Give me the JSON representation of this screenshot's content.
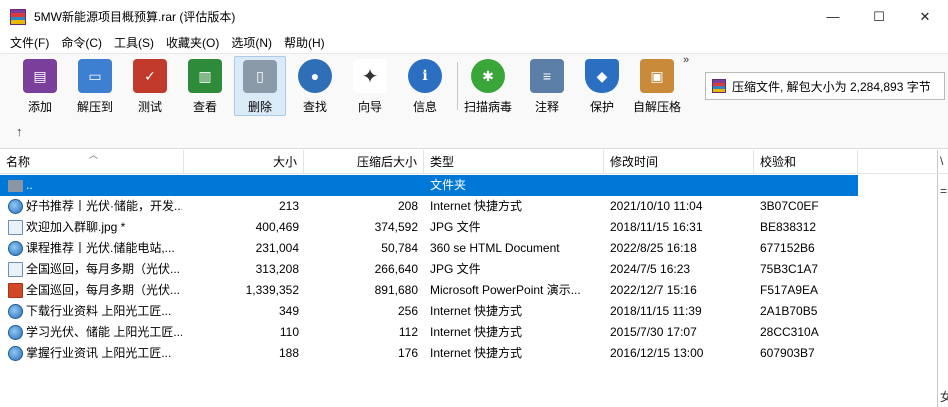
{
  "window": {
    "title": "5MW新能源项目概预算.rar (评估版本)",
    "controls": {
      "minimize": "—",
      "maximize": "☐",
      "close": "✕"
    }
  },
  "menu": [
    "文件(F)",
    "命令(C)",
    "工具(S)",
    "收藏夹(O)",
    "选项(N)",
    "帮助(H)"
  ],
  "toolbar": {
    "buttons": [
      {
        "label": "添加",
        "icon": "add-archive-icon",
        "color": "#7a3f9a"
      },
      {
        "label": "解压到",
        "icon": "extract-to-icon",
        "color": "#3d7fd1"
      },
      {
        "label": "测试",
        "icon": "test-clipboard-icon",
        "color": "#c0392b"
      },
      {
        "label": "查看",
        "icon": "view-book-icon",
        "color": "#2e8b3a"
      },
      {
        "label": "删除",
        "icon": "trash-icon",
        "color": "#8a9aa8"
      },
      {
        "label": "查找",
        "icon": "find-magnifier-icon",
        "color": "#2f6fb8"
      },
      {
        "label": "向导",
        "icon": "wizard-wand-icon",
        "color": "#5a5a5a"
      },
      {
        "label": "信息",
        "icon": "info-icon",
        "color": "#2a6fc2"
      },
      {
        "label": "扫描病毒",
        "icon": "virus-scan-icon",
        "color": "#3aa63a"
      },
      {
        "label": "注释",
        "icon": "comment-icon",
        "color": "#5b7fa6"
      },
      {
        "label": "保护",
        "icon": "shield-icon",
        "color": "#2a6fc2"
      },
      {
        "label": "自解压格",
        "icon": "sfx-box-icon",
        "color": "#c98a3a"
      }
    ],
    "more": "»"
  },
  "status": {
    "text": "压缩文件, 解包大小为 2,284,893 字节"
  },
  "nav": {
    "up": "↑"
  },
  "columns": [
    "名称",
    "大小",
    "压缩后大小",
    "类型",
    "修改时间",
    "校验和"
  ],
  "sort_caret": "︿",
  "files": [
    {
      "name": "..",
      "size": "",
      "packed": "",
      "type": "文件夹",
      "modified": "",
      "crc": "",
      "icon": "folder",
      "selected": true
    },
    {
      "name": "好书推荐丨光伏·储能，开发...",
      "size": "213",
      "packed": "208",
      "type": "Internet 快捷方式",
      "modified": "2021/10/10 11:04",
      "crc": "3B07C0EF",
      "icon": "web"
    },
    {
      "name": "欢迎加入群聊.jpg *",
      "size": "400,469",
      "packed": "374,592",
      "type": "JPG 文件",
      "modified": "2018/11/15 16:31",
      "crc": "BE838312",
      "icon": "jpg"
    },
    {
      "name": "课程推荐丨光伏.储能电站,...",
      "size": "231,004",
      "packed": "50,784",
      "type": "360 se HTML Document",
      "modified": "2022/8/25 16:18",
      "crc": "677152B6",
      "icon": "html"
    },
    {
      "name": "全国巡回，每月多期（光伏...",
      "size": "313,208",
      "packed": "266,640",
      "type": "JPG 文件",
      "modified": "2024/7/5 16:23",
      "crc": "75B3C1A7",
      "icon": "jpg"
    },
    {
      "name": "全国巡回，每月多期（光伏...",
      "size": "1,339,352",
      "packed": "891,680",
      "type": "Microsoft PowerPoint 演示...",
      "modified": "2022/12/7 15:16",
      "crc": "F517A9EA",
      "icon": "ppt"
    },
    {
      "name": "下载行业资料 上阳光工匠...",
      "size": "349",
      "packed": "256",
      "type": "Internet 快捷方式",
      "modified": "2018/11/15 11:39",
      "crc": "2A1B70B5",
      "icon": "web"
    },
    {
      "name": "学习光伏、储能 上阳光工匠...",
      "size": "110",
      "packed": "112",
      "type": "Internet 快捷方式",
      "modified": "2015/7/30 17:07",
      "crc": "28CC310A",
      "icon": "web"
    },
    {
      "name": "掌握行业资讯 上阳光工匠...",
      "size": "188",
      "packed": "176",
      "type": "Internet 快捷方式",
      "modified": "2016/12/15 13:00",
      "crc": "607903B7",
      "icon": "web"
    }
  ],
  "right_pane": {
    "marks": [
      "\\",
      "=",
      "女"
    ]
  }
}
